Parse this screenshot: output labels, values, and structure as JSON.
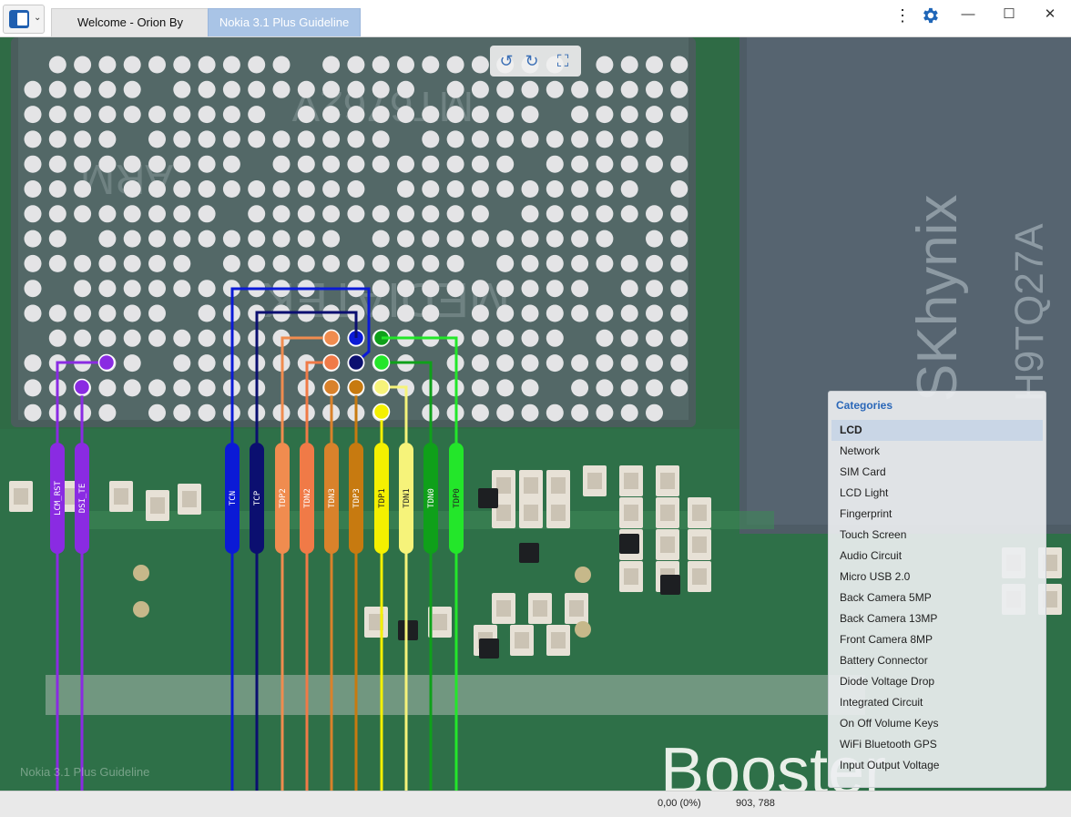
{
  "tabs": [
    {
      "label": "Welcome - Orion By ESTECH"
    },
    {
      "label": "Nokia 3.1 Plus Guideline"
    }
  ],
  "colors": {
    "accent": "#2a67b8",
    "tab_active_bg": "#a9c4e6",
    "board_green": "#2f6b45"
  },
  "chip_labels": {
    "mtk_text": [
      "ARM",
      "MT6762V",
      "MEDIATEK"
    ],
    "hynix_text": [
      "SKhynix",
      "H9TQ27A"
    ],
    "bottom_text": "Booster"
  },
  "signals": [
    {
      "name": "LCM_RST",
      "color": "#8a2be2"
    },
    {
      "name": "DSI_TE",
      "color": "#8a2be2"
    },
    {
      "name": "TCN",
      "color": "#0b1ad6"
    },
    {
      "name": "TCP",
      "color": "#0b0f70"
    },
    {
      "name": "TDP2",
      "color": "#f08c4f"
    },
    {
      "name": "TDN2",
      "color": "#f07a47"
    },
    {
      "name": "TDN3",
      "color": "#d9822b"
    },
    {
      "name": "TDP3",
      "color": "#c77a10"
    },
    {
      "name": "TDP1",
      "color": "#f4f000"
    },
    {
      "name": "TDN1",
      "color": "#f6f37a"
    },
    {
      "name": "TDN0",
      "color": "#0fa01a"
    },
    {
      "name": "TDP0",
      "color": "#23e62a"
    }
  ],
  "categories": {
    "title": "Categories",
    "items": [
      "LCD",
      "Network",
      "SIM Card",
      "LCD Light",
      "Fingerprint",
      "Touch Screen",
      "Audio Circuit",
      "Micro USB 2.0",
      "Back Camera 5MP",
      "Back Camera 13MP",
      "Front Camera 8MP",
      "Battery Connector",
      "Diode Voltage Drop",
      "Integrated Circuit",
      "On Off Volume Keys",
      "WiFi Bluetooth GPS",
      "Input Output Voltage"
    ],
    "selected": "LCD"
  },
  "watermark": "Nokia 3.1 Plus Guideline",
  "status": {
    "zoom": "0,00 (0%)",
    "coords": "903, 788"
  },
  "icons": {
    "menu": "sidebar-toggle-icon",
    "more": "kebab-icon",
    "settings": "gear-icon",
    "rotate_left": "rotate-left-icon",
    "rotate_right": "rotate-right-icon",
    "fit": "fit-screen-icon"
  }
}
